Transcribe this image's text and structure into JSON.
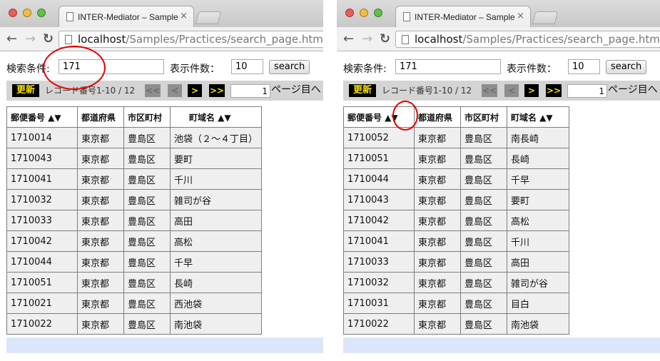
{
  "browser": {
    "tab_title": "INTER-Mediator – Sample",
    "url_host": "localhost",
    "url_path": "/Samples/Practices/search_page.html",
    "tab_close_icon": "×",
    "back_icon": "←",
    "forward_icon": "→",
    "reload_icon": "↻"
  },
  "colors": {
    "annotation": "#e00000",
    "update_button_bg": "#000000",
    "update_button_text": "#f5e400"
  },
  "left": {
    "search": {
      "label": "検索条件:",
      "value": "171",
      "count_label": "表示件数：",
      "count_value": "10",
      "button": "search"
    },
    "navigator": {
      "update": "更新",
      "info": "レコード番号1-10 / 12",
      "first": "<<",
      "prev": "<",
      "next": ">",
      "last": ">>",
      "page_value": "1",
      "page_label": "ページ目へ"
    },
    "headers": [
      "郵便番号 ▲▼",
      "都道府県",
      "市区町村",
      "町域名 ▲▼"
    ],
    "rows": [
      [
        "1710014",
        "東京都",
        "豊島区",
        "池袋（２〜４丁目）"
      ],
      [
        "1710043",
        "東京都",
        "豊島区",
        "要町"
      ],
      [
        "1710041",
        "東京都",
        "豊島区",
        "千川"
      ],
      [
        "1710032",
        "東京都",
        "豊島区",
        "雑司が谷"
      ],
      [
        "1710033",
        "東京都",
        "豊島区",
        "高田"
      ],
      [
        "1710042",
        "東京都",
        "豊島区",
        "高松"
      ],
      [
        "1710044",
        "東京都",
        "豊島区",
        "千早"
      ],
      [
        "1710051",
        "東京都",
        "豊島区",
        "長崎"
      ],
      [
        "1710021",
        "東京都",
        "豊島区",
        "西池袋"
      ],
      [
        "1710022",
        "東京都",
        "豊島区",
        "南池袋"
      ]
    ]
  },
  "right": {
    "search": {
      "label": "検索条件:",
      "value": "171",
      "count_label": "表示件数：",
      "count_value": "10",
      "button": "search"
    },
    "navigator": {
      "update": "更新",
      "info": "レコード番号1-10 / 12",
      "first": "<<",
      "prev": "<",
      "next": ">",
      "last": ">>",
      "page_value": "1",
      "page_label": "ページ目へ"
    },
    "headers": [
      "郵便番号 ▲▼",
      "都道府県",
      "市区町村",
      "町域名 ▲▼"
    ],
    "rows": [
      [
        "1710052",
        "東京都",
        "豊島区",
        "南長崎"
      ],
      [
        "1710051",
        "東京都",
        "豊島区",
        "長崎"
      ],
      [
        "1710044",
        "東京都",
        "豊島区",
        "千早"
      ],
      [
        "1710043",
        "東京都",
        "豊島区",
        "要町"
      ],
      [
        "1710042",
        "東京都",
        "豊島区",
        "高松"
      ],
      [
        "1710041",
        "東京都",
        "豊島区",
        "千川"
      ],
      [
        "1710033",
        "東京都",
        "豊島区",
        "高田"
      ],
      [
        "1710032",
        "東京都",
        "豊島区",
        "雑司が谷"
      ],
      [
        "1710031",
        "東京都",
        "豊島区",
        "目白"
      ],
      [
        "1710022",
        "東京都",
        "豊島区",
        "南池袋"
      ]
    ]
  }
}
